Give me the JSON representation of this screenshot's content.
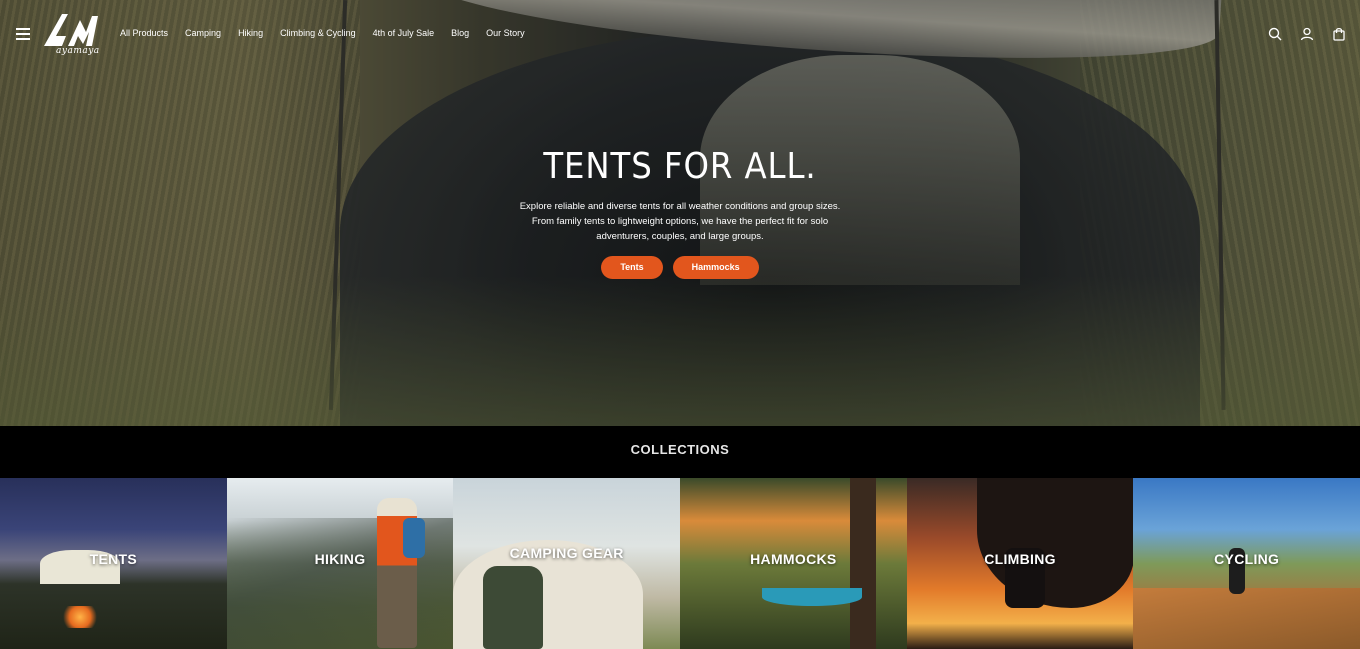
{
  "brand": {
    "logo_mark": "AM",
    "logo_text": "ayamaya"
  },
  "nav": {
    "items": [
      "All Products",
      "Camping",
      "Hiking",
      "Climbing & Cycling",
      "4th of July Sale",
      "Blog",
      "Our Story"
    ]
  },
  "header_icons": [
    "menu-icon",
    "search-icon",
    "account-icon",
    "cart-icon"
  ],
  "hero": {
    "title": "TENTS FOR ALL.",
    "description": "Explore reliable and diverse tents for all weather conditions and group sizes. From family tents to lightweight options, we have the perfect fit for solo adventurers, couples, and large groups.",
    "buttons": [
      "Tents",
      "Hammocks"
    ]
  },
  "collections": {
    "title": "COLLECTIONS",
    "cards": [
      "TENTS",
      "HIKING",
      "CAMPING GEAR",
      "HAMMOCKS",
      "CLIMBING",
      "CYCLING"
    ]
  },
  "colors": {
    "accent": "#e2561d",
    "background": "#000000",
    "text": "#ffffff"
  }
}
